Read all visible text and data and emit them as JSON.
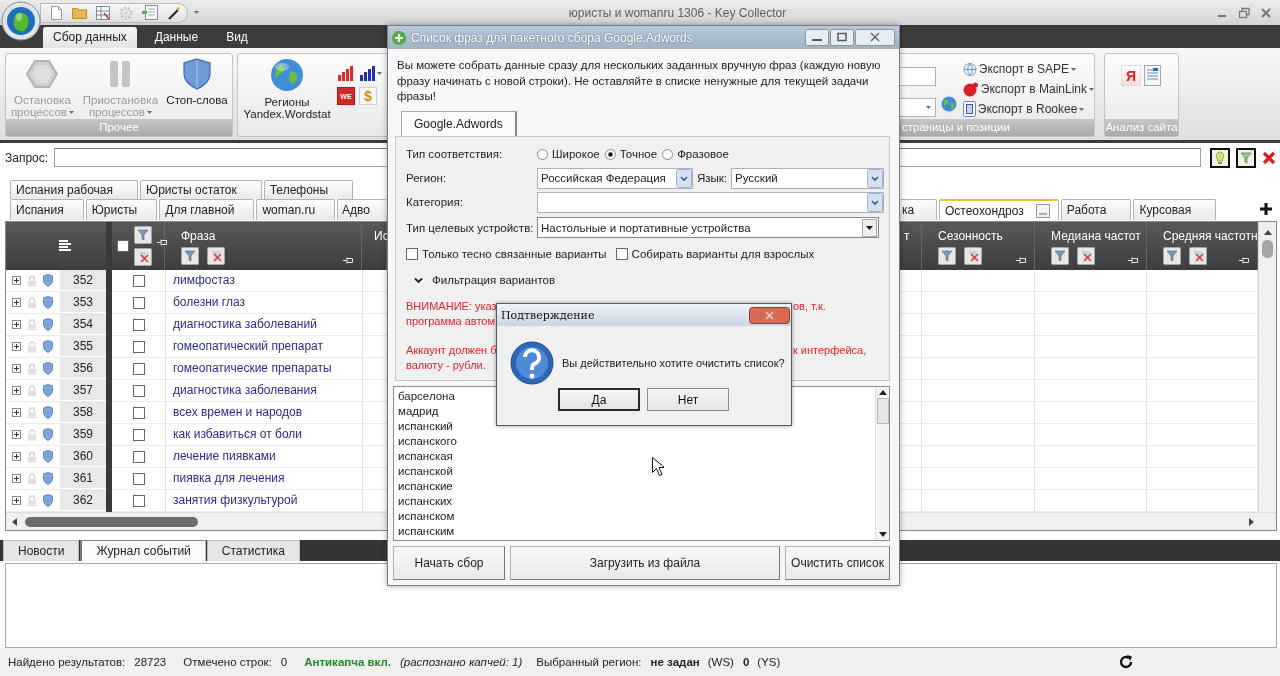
{
  "window": {
    "title": "юристы и womanru 1306 - Key Collector"
  },
  "ribbon_tabs": [
    {
      "label": "Сбор данных",
      "selected": true
    },
    {
      "label": "Данные",
      "selected": false
    },
    {
      "label": "Вид",
      "selected": false
    }
  ],
  "ribbon": {
    "process_group": {
      "label": "Прочее",
      "buttons": [
        {
          "label": "Остановка процессов",
          "disabled": true,
          "dropdown": true
        },
        {
          "label": "Приостановка процессов",
          "disabled": true,
          "dropdown": true
        },
        {
          "label": "Стоп-слова",
          "disabled": false,
          "dropdown": false
        }
      ]
    },
    "wordstat_group": {
      "button": "Регионы Yandex.Wordstat",
      "tools": [
        {
          "kind": "chart",
          "color": "#d42a2a",
          "dropdown": false
        },
        {
          "kind": "chart",
          "color": "#1f2fb0",
          "dropdown": true
        },
        {
          "kind": "badge",
          "text": "WE",
          "dropdown": false
        },
        {
          "kind": "coin",
          "text": "$",
          "dropdown": false
        }
      ]
    },
    "export_group": {
      "label": "страницы и позиции",
      "links": [
        "Экспорт в SAPE",
        "Экспорт в MainLink",
        "Экспорт в Rookee"
      ]
    },
    "analysis_group": {
      "label": "Анализ сайта",
      "tools": [
        {
          "kind": "letter",
          "text": "Я"
        },
        {
          "kind": "document"
        }
      ]
    }
  },
  "query": {
    "label": "Запрос:"
  },
  "phrase_tabs": {
    "upper_row": [
      {
        "label": "Испания рабочая",
        "selected": false
      },
      {
        "label": "Юристы остаток",
        "selected": false
      },
      {
        "label": "Телефоны",
        "selected": false
      }
    ],
    "lower_row_left": [
      {
        "label": "Испания",
        "selected": false
      },
      {
        "label": "Юристы",
        "selected": false
      },
      {
        "label": "Для главной",
        "selected": false
      },
      {
        "label": "woman.ru",
        "selected": false
      },
      {
        "label": "Адво",
        "selected": false
      }
    ],
    "lower_row_right": [
      {
        "label": "ка",
        "selected": false
      },
      {
        "label": "Остеохондроз",
        "selected": true
      },
      {
        "label": "Работа",
        "selected": false
      },
      {
        "label": "Курсовая",
        "selected": false
      }
    ]
  },
  "grid": {
    "header_checked": false,
    "columns_left": [
      "Фраза",
      "Ис"
    ],
    "columns_right": [
      "т",
      "Сезонность",
      "Медиана частот",
      "Средняя частотн"
    ],
    "rows": [
      {
        "number": "352",
        "expanded": false,
        "checked": false,
        "phrase": "лимфостаз"
      },
      {
        "number": "353",
        "expanded": false,
        "checked": false,
        "phrase": "болезни глаз"
      },
      {
        "number": "354",
        "expanded": false,
        "checked": false,
        "phrase": "диагностика заболеваний"
      },
      {
        "number": "355",
        "expanded": false,
        "checked": false,
        "phrase": "гомеопатический препарат"
      },
      {
        "number": "356",
        "expanded": false,
        "checked": false,
        "phrase": "гомеопатические препараты"
      },
      {
        "number": "357",
        "expanded": false,
        "checked": false,
        "phrase": "диагностика заболевания"
      },
      {
        "number": "358",
        "expanded": false,
        "checked": false,
        "phrase": "всех времен и народов"
      },
      {
        "number": "359",
        "expanded": false,
        "checked": false,
        "phrase": "как избавиться от боли"
      },
      {
        "number": "360",
        "expanded": false,
        "checked": false,
        "phrase": "лечение пиявками"
      },
      {
        "number": "361",
        "expanded": false,
        "checked": false,
        "phrase": "пиявка для лечения"
      },
      {
        "number": "362",
        "expanded": false,
        "checked": false,
        "phrase": "занятия физкультурой"
      }
    ]
  },
  "bottom_tabs": [
    {
      "label": "Новости",
      "selected": false
    },
    {
      "label": "Журнал событий",
      "selected": true
    },
    {
      "label": "Статистика",
      "selected": false
    }
  ],
  "status_bar": [
    {
      "kind": "label",
      "text": "Найдено результатов:"
    },
    {
      "kind": "value",
      "text": "28723"
    },
    {
      "kind": "label",
      "text": "Отмечено строк:"
    },
    {
      "kind": "value",
      "text": "0"
    },
    {
      "kind": "ok",
      "text": "Антикапча вкл."
    },
    {
      "kind": "note",
      "text": "(распознано капчей: 1)"
    },
    {
      "kind": "label",
      "text": "Выбранный регион:"
    },
    {
      "kind": "strong",
      "text": "не задан"
    },
    {
      "kind": "label",
      "text": "(WS)"
    },
    {
      "kind": "strong",
      "text": "0"
    },
    {
      "kind": "label",
      "text": "(YS)"
    }
  ],
  "phrase_dialog": {
    "title": "Список фраз для пакетного сбора Google.Adwords",
    "description": "Вы можете собрать данные сразу для нескольких заданных вручную фраз (каждую новую фразу начинать с новой строки). Не оставляйте в списке ненужные для текущей задачи фразы!",
    "tabs": [
      {
        "label": "Google.Adwords",
        "selected": true
      }
    ],
    "match_type": {
      "label": "Тип соответствия:",
      "options": [
        {
          "label": "Широкое",
          "selected": false
        },
        {
          "label": "Точное",
          "selected": true
        },
        {
          "label": "Фразовое",
          "selected": false
        }
      ]
    },
    "region": {
      "label": "Регион:",
      "value": "Российская Федерация"
    },
    "language": {
      "label": "Язык:",
      "value": "Русский"
    },
    "category": {
      "label": "Категория:"
    },
    "devices": {
      "label": "Тип целевых устройств:",
      "value": "Настольные и портативные устройства"
    },
    "options": [
      {
        "label": "Только тесно связанные варианты",
        "checked": false
      },
      {
        "label": "Собирать варианты для взрослых",
        "checked": false
      }
    ],
    "filter": {
      "label": "Фильтрация вариантов",
      "expanded": true
    },
    "warnings": [
      [
        {
          "left": "ВНИМАНИЕ: указ",
          "right": "ов, т.к."
        },
        {
          "left": "программа автом"
        }
      ],
      [
        {
          "left": "Аккаунт должен б",
          "right": "к интерфейса,"
        },
        {
          "left": "валюту - рубли."
        }
      ]
    ],
    "phrases": [
      "барселона",
      "мадрид",
      "испанский",
      "испанского",
      "испанская",
      "испанской",
      "испанские",
      "испанских",
      "испанском",
      "испанским"
    ],
    "buttons": [
      "Начать сбор",
      "Загрузить из файла",
      "Очистить список"
    ]
  },
  "confirm_dialog": {
    "title": "Подтверждение",
    "message": "Вы действительно хотите очистить список?",
    "buttons": [
      {
        "label": "Да",
        "default": true
      },
      {
        "label": "Нет",
        "default": false
      }
    ]
  }
}
